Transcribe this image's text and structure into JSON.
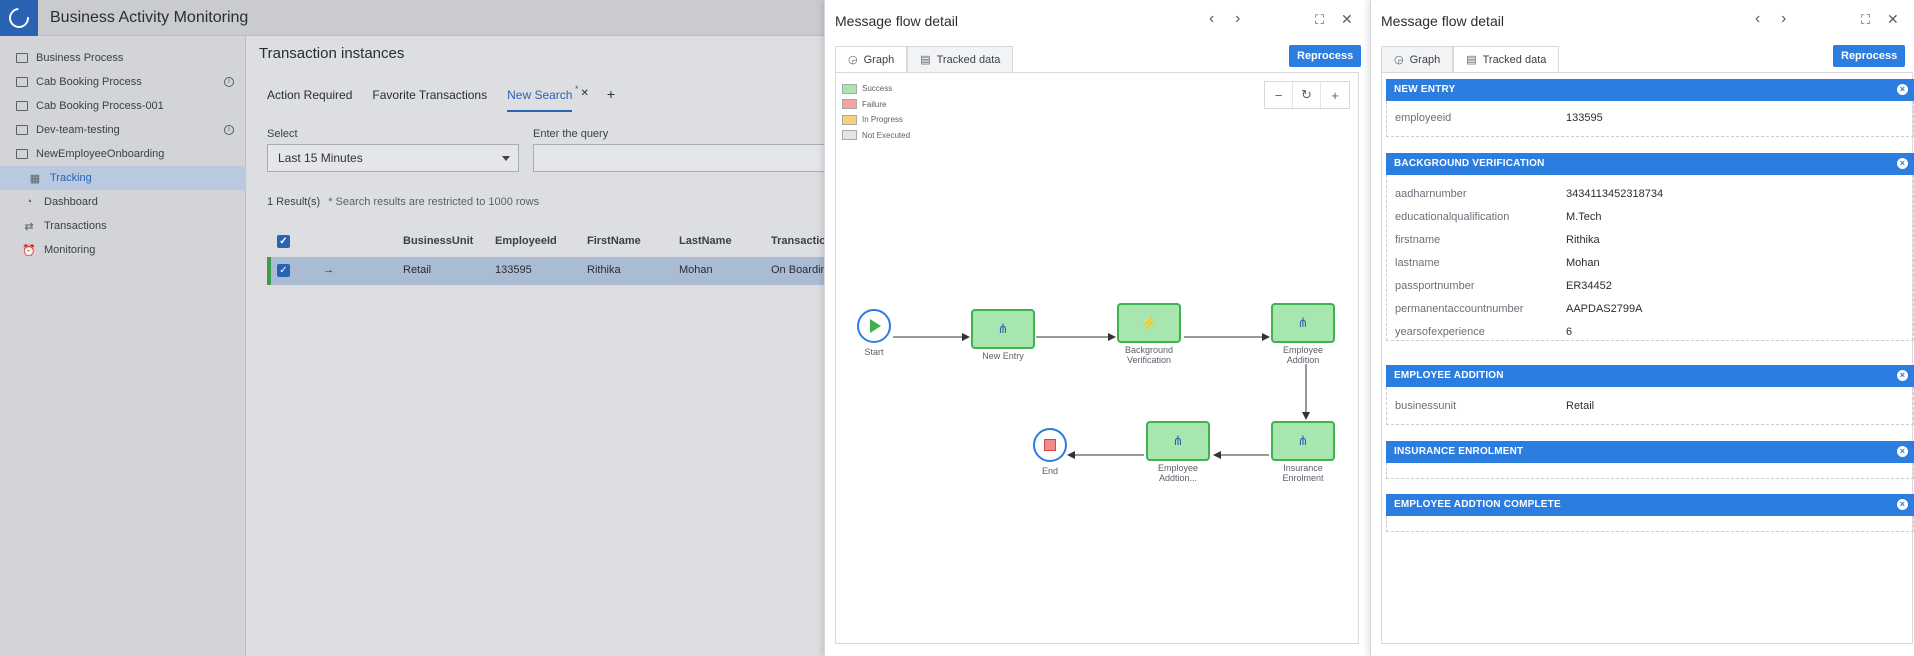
{
  "app": {
    "title": "Business Activity Monitoring"
  },
  "sidebar": {
    "items": [
      {
        "label": "Business Process",
        "info": false
      },
      {
        "label": "Cab Booking Process",
        "info": true
      },
      {
        "label": "Cab Booking Process-001",
        "info": false
      },
      {
        "label": "Dev-team-testing",
        "info": true
      },
      {
        "label": "NewEmployeeOnboarding",
        "info": false
      }
    ],
    "sub_items": [
      {
        "label": "Tracking",
        "active": true
      },
      {
        "label": "Dashboard",
        "active": false
      },
      {
        "label": "Transactions",
        "active": false
      },
      {
        "label": "Monitoring",
        "active": false
      }
    ],
    "collapse_glyph": "«"
  },
  "main": {
    "title": "Transaction instances",
    "tabs": [
      "Action Required",
      "Favorite Transactions",
      "New Search"
    ],
    "select_label": "Select",
    "select_value": "Last 15 Minutes",
    "query_label": "Enter the query",
    "results_count": "1 Result(s)",
    "results_note": "* Search results are restricted to 1000 rows",
    "columns": [
      "BusinessUnit",
      "EmployeeId",
      "FirstName",
      "LastName",
      "Transaction"
    ],
    "row": [
      "Retail",
      "133595",
      "Rithika",
      "Mohan",
      "On Boardin"
    ]
  },
  "panel1": {
    "title": "Message flow detail",
    "tabs": [
      "Graph",
      "Tracked data"
    ],
    "reprocess": "Reprocess",
    "legend": [
      {
        "label": "Success",
        "color": "#a8e6b0"
      },
      {
        "label": "Failure",
        "color": "#f6a3a3"
      },
      {
        "label": "In Progress",
        "color": "#f5d27a"
      },
      {
        "label": "Not Executed",
        "color": "#e3e5e8"
      }
    ],
    "flow": {
      "start": "Start",
      "end": "End",
      "nodes": [
        {
          "label1": "New Entry",
          "label2": ""
        },
        {
          "label1": "Background",
          "label2": "Verification"
        },
        {
          "label1": "Employee",
          "label2": "Addition"
        },
        {
          "label1": "Insurance",
          "label2": "Enrolment"
        },
        {
          "label1": "Employee",
          "label2": "Addtion..."
        }
      ]
    }
  },
  "panel2": {
    "title": "Message flow detail",
    "tabs": [
      "Graph",
      "Tracked data"
    ],
    "reprocess": "Reprocess",
    "sections": [
      {
        "title": "NEW ENTRY",
        "fields": [
          {
            "k": "employeeid",
            "v": "133595"
          }
        ]
      },
      {
        "title": "BACKGROUND VERIFICATION",
        "fields": [
          {
            "k": "aadharnumber",
            "v": "3434113452318734"
          },
          {
            "k": "educationalqualification",
            "v": "M.Tech"
          },
          {
            "k": "firstname",
            "v": "Rithika"
          },
          {
            "k": "lastname",
            "v": "Mohan"
          },
          {
            "k": "passportnumber",
            "v": "ER34452"
          },
          {
            "k": "permanentaccountnumber",
            "v": "AAPDAS2799A"
          },
          {
            "k": "yearsofexperience",
            "v": "6"
          }
        ]
      },
      {
        "title": "EMPLOYEE ADDITION",
        "fields": [
          {
            "k": "businessunit",
            "v": "Retail"
          }
        ]
      },
      {
        "title": "INSURANCE ENROLMENT",
        "fields": []
      },
      {
        "title": "EMPLOYEE ADDTION COMPLETE",
        "fields": []
      }
    ]
  }
}
